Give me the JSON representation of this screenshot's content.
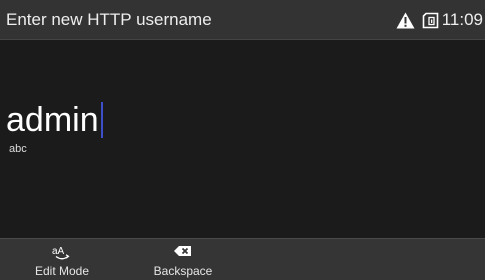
{
  "header": {
    "title": "Enter new HTTP username",
    "status_icons": [
      "warning-icon",
      "sim-card-icon"
    ],
    "clock": "11:09"
  },
  "input": {
    "value": "admin",
    "mode": "abc"
  },
  "softkeys": [
    {
      "label": "Edit Mode",
      "icon": "edit-mode-icon",
      "icon_text": "aA"
    },
    {
      "label": "Backspace",
      "icon": "backspace-icon"
    }
  ],
  "colors": {
    "background": "#1b1b1b",
    "title_bar": "#333333",
    "soft_bar": "#353535",
    "text": "#ffffff",
    "caret": "#3d4ec9"
  }
}
